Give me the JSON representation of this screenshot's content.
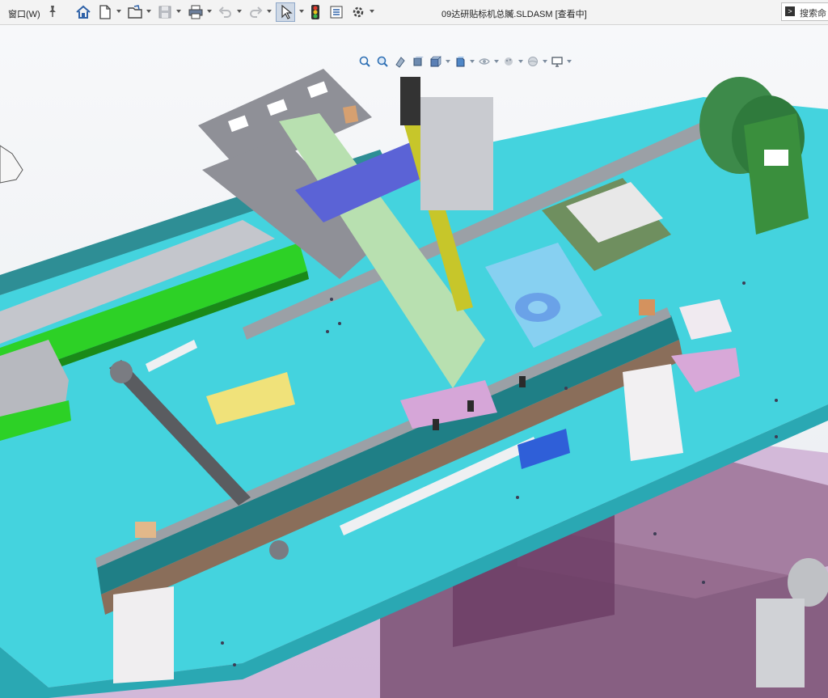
{
  "menu": {
    "window_label": "窗口(W)"
  },
  "toolbar": {
    "buttons": [
      {
        "name": "home-icon"
      },
      {
        "name": "new-document-icon"
      },
      {
        "name": "open-folder-icon"
      },
      {
        "name": "save-icon"
      },
      {
        "name": "print-icon"
      },
      {
        "name": "undo-icon"
      },
      {
        "name": "redo-icon"
      },
      {
        "name": "select-pointer-icon"
      },
      {
        "name": "rebuild-traffic-light-icon"
      },
      {
        "name": "file-properties-icon"
      },
      {
        "name": "options-gear-icon"
      }
    ]
  },
  "document": {
    "title": "09达研贴标机总贓.SLDASM [查看中]"
  },
  "search": {
    "placeholder": "搜索命"
  },
  "heads_up_toolbar": {
    "items": [
      "zoom-to-fit-icon",
      "zoom-to-area-icon",
      "previous-view-icon",
      "section-view-icon",
      "view-orientation-icon",
      "display-style-icon",
      "hide-show-items-icon",
      "edit-appearance-icon",
      "apply-scene-icon",
      "view-settings-icon"
    ]
  },
  "colors": {
    "table_top": "#3fd2dc",
    "rail_teal": "#1f7f86",
    "frame_purple": "#c9a9cf",
    "green_part": "#34d32a",
    "grey_plate": "#8f9097",
    "blue_plate": "#5b63d6"
  }
}
